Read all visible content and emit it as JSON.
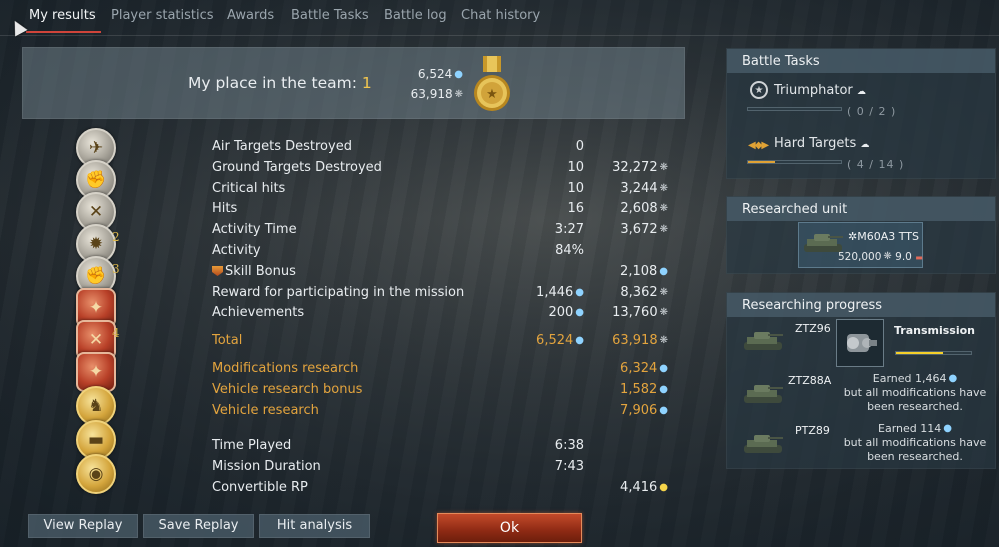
{
  "tabs": [
    "My results",
    "Player statistics",
    "Awards",
    "Battle Tasks",
    "Battle log",
    "Chat history"
  ],
  "summary": {
    "place_label": "My place in the team:",
    "place_value": "1",
    "silver_lions": "6,524",
    "research_points": "63,918"
  },
  "ribbon": {
    "labels": [
      "2",
      "3",
      "4"
    ]
  },
  "stats": [
    {
      "label": "Air Targets Destroyed",
      "v1": "0",
      "v2": ""
    },
    {
      "label": "Ground Targets Destroyed",
      "v1": "10",
      "v2": "32,272"
    },
    {
      "label": "Critical hits",
      "v1": "10",
      "v2": "3,244"
    },
    {
      "label": "Hits",
      "v1": "16",
      "v2": "2,608"
    },
    {
      "label": "Activity Time",
      "v1": "3:27",
      "v2": "3,672"
    },
    {
      "label": "Activity",
      "v1": "84%",
      "v2": ""
    },
    {
      "label": "Skill Bonus",
      "v1": "",
      "v2": "2,108"
    },
    {
      "label": "Reward for participating in the mission",
      "v1": "1,446",
      "v2": "8,362"
    },
    {
      "label": "Achievements",
      "v1": "200",
      "v2": "13,760"
    }
  ],
  "total": {
    "label": "Total",
    "v1": "6,524",
    "v2": "63,918"
  },
  "research": [
    {
      "label": "Modifications research",
      "v2": "6,324"
    },
    {
      "label": "Vehicle research bonus",
      "v2": "1,582"
    },
    {
      "label": "Vehicle research",
      "v2": "7,906"
    }
  ],
  "time": [
    {
      "label": "Time Played",
      "v1": "6:38",
      "v2": ""
    },
    {
      "label": "Mission Duration",
      "v1": "7:43",
      "v2": ""
    },
    {
      "label": "Convertible RP",
      "v1": "",
      "v2": "4,416"
    }
  ],
  "battle_tasks": {
    "title": "Battle Tasks",
    "items": [
      {
        "name": "Triumphator",
        "progress": "( 0 / 2 )",
        "fraction": 0.0
      },
      {
        "name": "Hard Targets",
        "progress": "( 4 / 14 )",
        "fraction": 0.29
      }
    ]
  },
  "researched_unit": {
    "title": "Researched unit",
    "name": "M60A3 TTS",
    "cost": "520,000",
    "br": "9.0"
  },
  "researching": {
    "title": "Researching progress",
    "vehicles": [
      {
        "name": "ZTZ96"
      },
      {
        "name": "ZTZ88A",
        "note1": "Earned 1,464",
        "note2": "but all modifications have been researched."
      },
      {
        "name": "PTZ89",
        "note1": "Earned 114",
        "note2": "but all modifications have been researched."
      }
    ],
    "module": {
      "name": "Transmission",
      "progress": 0.62
    }
  },
  "buttons": {
    "view_replay": "View Replay",
    "save_replay": "Save Replay",
    "hit_analysis": "Hit analysis",
    "ok": "Ok"
  },
  "colors": {
    "accent_orange": "#e3a43e",
    "ok_red": "#a7341b",
    "tab_underline": "#d0443a"
  }
}
